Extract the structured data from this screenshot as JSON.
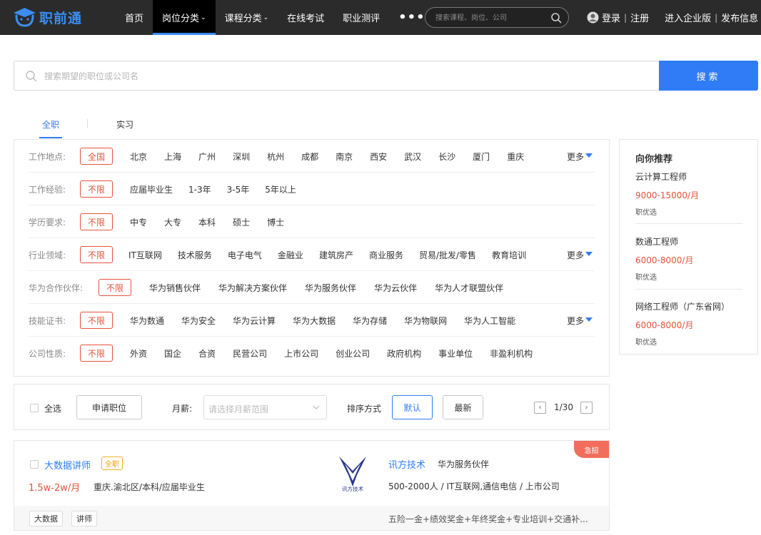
{
  "header": {
    "logo_text": "职前通",
    "nav": [
      {
        "label": "首页",
        "caret": false,
        "active": false
      },
      {
        "label": "岗位分类",
        "caret": true,
        "active": true
      },
      {
        "label": "课程分类",
        "caret": true,
        "active": false
      },
      {
        "label": "在线考试",
        "caret": false,
        "active": false
      },
      {
        "label": "职业测评",
        "caret": false,
        "active": false
      }
    ],
    "more_label": "•••",
    "search_placeholder": "搜索课程、岗位、公司",
    "login": "登录",
    "register": "注册",
    "enterprise": "进入企业版",
    "publish": "发布信息",
    "separator": "|"
  },
  "main_search": {
    "placeholder": "搜索期望的职位或公司名",
    "button": "搜索"
  },
  "tabs": {
    "full_time": "全职",
    "internship": "实习"
  },
  "filters": [
    {
      "label": "工作地点:",
      "options": [
        "全国",
        "北京",
        "上海",
        "广州",
        "深圳",
        "杭州",
        "成都",
        "南京",
        "西安",
        "武汉",
        "长沙",
        "厦门",
        "重庆"
      ],
      "selected": 0,
      "more": "更多"
    },
    {
      "label": "工作经验:",
      "options": [
        "不限",
        "应届毕业生",
        "1-3年",
        "3-5年",
        "5年以上"
      ],
      "selected": 0,
      "more": ""
    },
    {
      "label": "学历要求:",
      "options": [
        "不限",
        "中专",
        "大专",
        "本科",
        "硕士",
        "博士"
      ],
      "selected": 0,
      "more": ""
    },
    {
      "label": "行业领域:",
      "options": [
        "不限",
        "IT互联网",
        "技术服务",
        "电子电气",
        "金融业",
        "建筑房产",
        "商业服务",
        "贸易/批发/零售",
        "教育培训"
      ],
      "selected": 0,
      "more": "更多"
    },
    {
      "label": "华为合作伙伴:",
      "options": [
        "不限",
        "华为销售伙伴",
        "华为解决方案伙伴",
        "华为服务伙伴",
        "华为云伙伴",
        "华为人才联盟伙伴"
      ],
      "selected": 0,
      "more": ""
    },
    {
      "label": "技能证书:",
      "options": [
        "不限",
        "华为数通",
        "华为安全",
        "华为云计算",
        "华为大数据",
        "华为存储",
        "华为物联网",
        "华为人工智能"
      ],
      "selected": 0,
      "more": "更多"
    },
    {
      "label": "公司性质:",
      "options": [
        "不限",
        "外资",
        "国企",
        "合资",
        "民营公司",
        "上市公司",
        "创业公司",
        "政府机构",
        "事业单位",
        "非盈利机构"
      ],
      "selected": 0,
      "more": ""
    }
  ],
  "recommend": {
    "title": "向你推荐",
    "items": [
      {
        "job": "云计算工程师",
        "salary": "9000-15000/月",
        "tag": "职优选"
      },
      {
        "job": "数通工程师",
        "salary": "6000-8000/月",
        "tag": "职优选"
      },
      {
        "job": "网络工程师（广东省网）",
        "salary": "6000-8000/月",
        "tag": "职优选"
      }
    ]
  },
  "toolbar": {
    "select_all": "全选",
    "apply": "申请职位",
    "salary_label": "月薪:",
    "salary_placeholder": "请选择月薪范围",
    "sort_label": "排序方式",
    "sort_default": "默认",
    "sort_latest": "最新",
    "page_prev": "‹",
    "page_next": "›",
    "page_text": "1/30"
  },
  "job": {
    "urgent": "急招",
    "title": "大数据讲师",
    "type": "全职",
    "salary": "1.5w-2w/月",
    "location": "重庆.渝北区/本科/应届毕业生",
    "logo_text": "讯方技术",
    "company": "讯方技术",
    "partner": "华为服务伙伴",
    "company_info": "500-2000人 / IT互联网,通信电信 / 上市公司",
    "tags": [
      "大数据",
      "讲师"
    ],
    "benefits": "五险一金+绩效奖金+年终奖金+专业培训+交通补..."
  },
  "colors": {
    "accent": "#2f7cf6",
    "selected": "#e5533c",
    "header_bg": "#2b2b2b",
    "urgent": "#f26d5b"
  }
}
